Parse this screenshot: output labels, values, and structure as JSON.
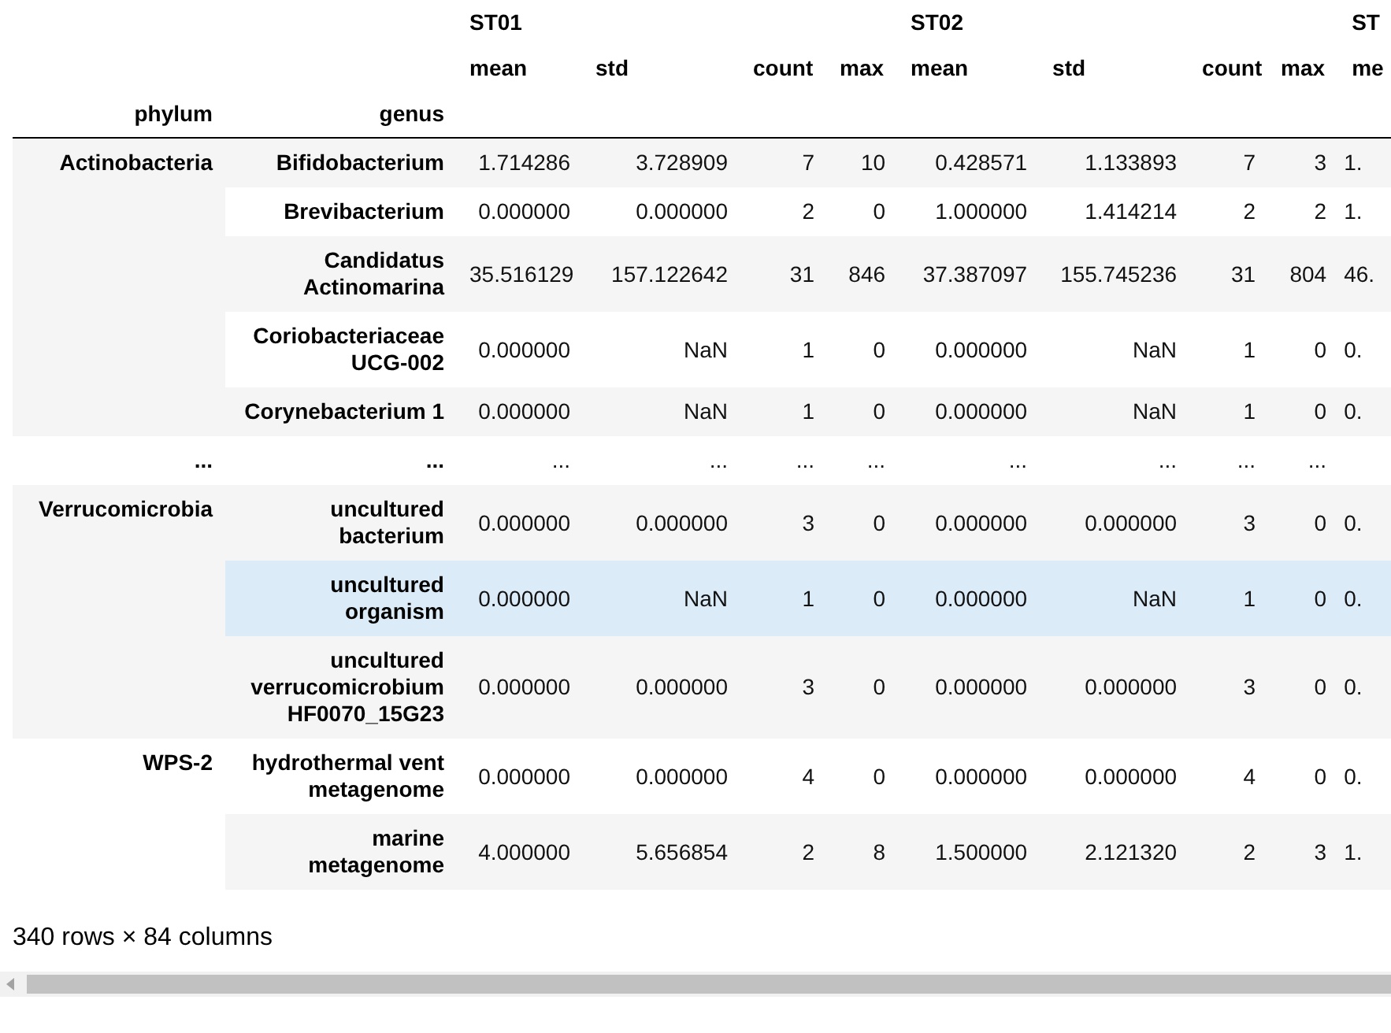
{
  "table": {
    "column_groups": [
      {
        "label": "ST01",
        "stats": [
          "mean",
          "std",
          "count",
          "max"
        ]
      },
      {
        "label": "ST02",
        "stats": [
          "mean",
          "std",
          "count",
          "max"
        ]
      },
      {
        "label": "ST",
        "stats": [
          "me"
        ]
      }
    ],
    "index_names": [
      "phylum",
      "genus"
    ],
    "groups": [
      {
        "phylum": "Actinobacteria",
        "rows": [
          {
            "genus": "Bifidobacterium",
            "values": [
              "1.714286",
              "3.728909",
              "7",
              "10",
              "0.428571",
              "1.133893",
              "7",
              "3",
              "1."
            ],
            "hovered": false
          },
          {
            "genus": "Brevibacterium",
            "values": [
              "0.000000",
              "0.000000",
              "2",
              "0",
              "1.000000",
              "1.414214",
              "2",
              "2",
              "1."
            ],
            "hovered": false
          },
          {
            "genus": "Candidatus Actinomarina",
            "values": [
              "35.516129",
              "157.122642",
              "31",
              "846",
              "37.387097",
              "155.745236",
              "31",
              "804",
              "46."
            ],
            "hovered": false
          },
          {
            "genus": "Coriobacteriaceae UCG-002",
            "values": [
              "0.000000",
              "NaN",
              "1",
              "0",
              "0.000000",
              "NaN",
              "1",
              "0",
              "0."
            ],
            "hovered": false
          },
          {
            "genus": "Corynebacterium 1",
            "values": [
              "0.000000",
              "NaN",
              "1",
              "0",
              "0.000000",
              "NaN",
              "1",
              "0",
              "0."
            ],
            "hovered": false
          }
        ]
      },
      {
        "phylum": "...",
        "rows": [
          {
            "genus": "...",
            "values": [
              "...",
              "...",
              "...",
              "...",
              "...",
              "...",
              "...",
              "..."
            ],
            "hovered": false
          }
        ]
      },
      {
        "phylum": "Verrucomicrobia",
        "rows": [
          {
            "genus": "uncultured bacterium",
            "values": [
              "0.000000",
              "0.000000",
              "3",
              "0",
              "0.000000",
              "0.000000",
              "3",
              "0",
              "0."
            ],
            "hovered": false
          },
          {
            "genus": "uncultured organism",
            "values": [
              "0.000000",
              "NaN",
              "1",
              "0",
              "0.000000",
              "NaN",
              "1",
              "0",
              "0."
            ],
            "hovered": true
          },
          {
            "genus": "uncultured verrucomicrobium HF0070_15G23",
            "values": [
              "0.000000",
              "0.000000",
              "3",
              "0",
              "0.000000",
              "0.000000",
              "3",
              "0",
              "0."
            ],
            "hovered": false
          }
        ]
      },
      {
        "phylum": "WPS-2",
        "rows": [
          {
            "genus": "hydrothermal vent metagenome",
            "values": [
              "0.000000",
              "0.000000",
              "4",
              "0",
              "0.000000",
              "0.000000",
              "4",
              "0",
              "0."
            ],
            "hovered": false
          },
          {
            "genus": "marine metagenome",
            "values": [
              "4.000000",
              "5.656854",
              "2",
              "8",
              "1.500000",
              "2.121320",
              "2",
              "3",
              "1."
            ],
            "hovered": false
          }
        ]
      }
    ]
  },
  "footer": "340 rows × 84 columns"
}
